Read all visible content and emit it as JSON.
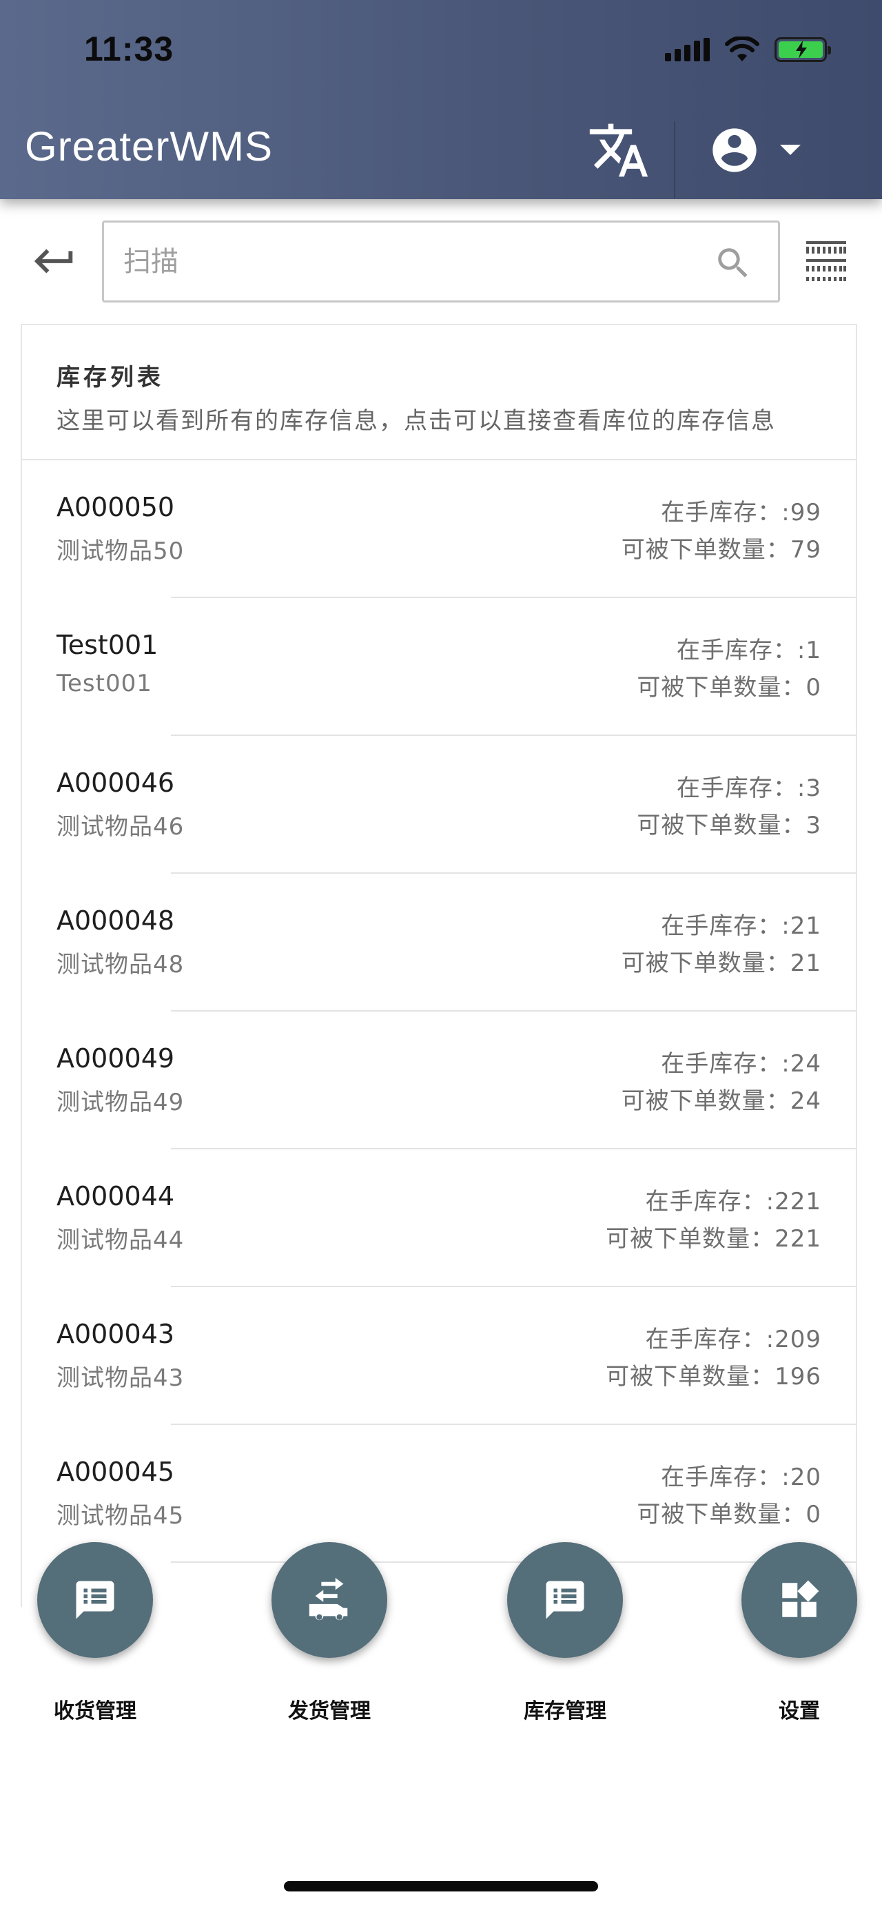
{
  "status_bar": {
    "time": "11:33"
  },
  "header": {
    "title": "GreaterWMS",
    "translate_icon": "translate-icon",
    "account_icon": "account-circle-icon",
    "dropdown_icon": "caret-down-icon"
  },
  "search": {
    "placeholder": "扫描",
    "value": "",
    "back_icon": "keyboard-return-icon",
    "search_icon": "search-icon",
    "barcode_icon": "barcode-scan-icon"
  },
  "inventory": {
    "title": "库存列表",
    "subtitle": "这里可以看到所有的库存信息，点击可以直接查看库位的库存信息",
    "items": [
      {
        "code": "A000050",
        "name": "测试物品50",
        "onhand": "在手库存：:99",
        "orderable": "可被下单数量：79"
      },
      {
        "code": "Test001",
        "name": "Test001",
        "onhand": "在手库存：:1",
        "orderable": "可被下单数量：0"
      },
      {
        "code": "A000046",
        "name": "测试物品46",
        "onhand": "在手库存：:3",
        "orderable": "可被下单数量：3"
      },
      {
        "code": "A000048",
        "name": "测试物品48",
        "onhand": "在手库存：:21",
        "orderable": "可被下单数量：21"
      },
      {
        "code": "A000049",
        "name": "测试物品49",
        "onhand": "在手库存：:24",
        "orderable": "可被下单数量：24"
      },
      {
        "code": "A000044",
        "name": "测试物品44",
        "onhand": "在手库存：:221",
        "orderable": "可被下单数量：221"
      },
      {
        "code": "A000043",
        "name": "测试物品43",
        "onhand": "在手库存：:209",
        "orderable": "可被下单数量：196"
      },
      {
        "code": "A000045",
        "name": "测试物品45",
        "onhand": "在手库存：:20",
        "orderable": "可被下单数量：0"
      }
    ]
  },
  "bottom_actions": [
    {
      "label": "收货管理",
      "icon": "message-list-icon"
    },
    {
      "label": "发货管理",
      "icon": "truck-transfer-icon"
    },
    {
      "label": "库存管理",
      "icon": "message-list-icon"
    },
    {
      "label": "设置",
      "icon": "widgets-icon"
    }
  ],
  "colors": {
    "header_start": "#5b6a8c",
    "header_end": "#3f4b6c",
    "fab": "#546e7a",
    "battery": "#3ccf4e"
  }
}
